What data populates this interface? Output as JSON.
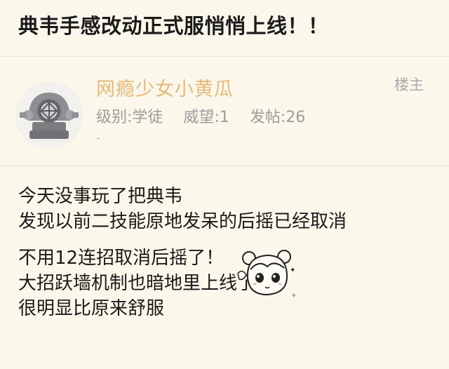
{
  "thread": {
    "title": "典韦手感改动正式服悄悄上线！！"
  },
  "post": {
    "author": {
      "name": "网瘾少女小黄瓜",
      "avatar_icon": "diving-helmet-icon",
      "name_color": "#e6b979"
    },
    "floor_label": "楼主",
    "stats": {
      "level": "级别:学徒",
      "prestige": "威望:1",
      "posts": "发帖:26"
    },
    "signature": "-",
    "body": {
      "lines": [
        "今天没事玩了把典韦",
        "发现以前二技能原地发呆的后摇已经取消",
        "不用12连招取消后摇了！",
        "大招跃墙机制也暗地里上线了",
        "很明显比原来舒服"
      ],
      "sticker_icon": "anime-girl-sticker-icon"
    }
  },
  "colors": {
    "background": "#fbf7ea",
    "username": "#e6b979",
    "meta_text": "#9c9c9c"
  }
}
